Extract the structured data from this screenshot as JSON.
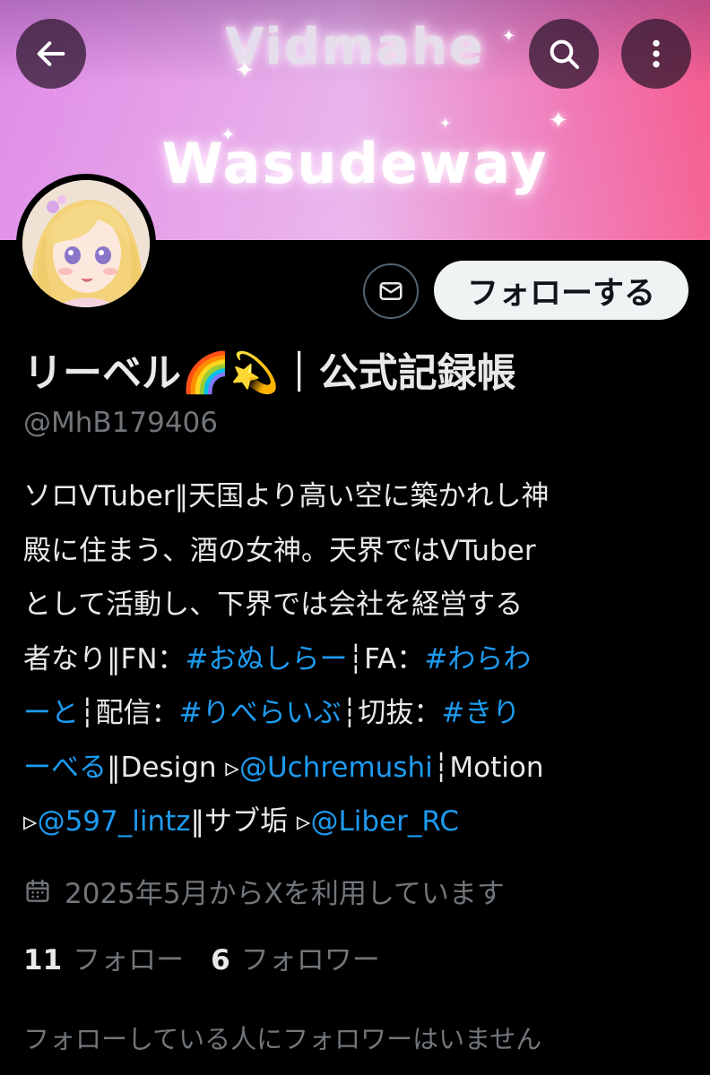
{
  "banner": {
    "line1": "Vidmahe",
    "line2": "Wasudeway"
  },
  "header": {
    "back_icon": "arrow-left-icon",
    "search_icon": "search-icon",
    "more_icon": "more-vertical-icon"
  },
  "profile": {
    "display_name": "リーベル🌈💫｜公式記録帳",
    "handle": "@MhB179406",
    "follow_label": "フォローする",
    "message_icon": "mail-icon"
  },
  "bio": {
    "l1": "ソロVTuber‖天国より高い空に築かれし神",
    "l2": "殿に住まう、酒の女神。天界ではVTuber",
    "l3": "として活動し、下界では会社を経営する",
    "l4_a": "者なり‖FN：",
    "l4_b": "#おぬしらー",
    "l4_c": "┆FA：",
    "l4_d": "#わらわ",
    "l5_a": "ーと",
    "l5_b": "┆配信：",
    "l5_c": "#りべらいぶ",
    "l5_d": "┆切抜：",
    "l5_e": "#きり",
    "l6_a": "ーべる",
    "l6_b": "‖Design ▹",
    "l6_c": "@Uchremushi",
    "l6_d": "┆Motion",
    "l7_a": "▹",
    "l7_b": "@597_lintz",
    "l7_c": "‖サブ垢 ▹",
    "l7_d": "@Liber_RC"
  },
  "joined": {
    "text": "2025年5月からXを利用しています",
    "icon": "calendar-icon"
  },
  "stats": {
    "following_count": "11",
    "following_label": "フォロー",
    "followers_count": "6",
    "followers_label": "フォロワー"
  },
  "mutual_note": "フォローしている人にフォロワーはいません",
  "colors": {
    "background": "#000000",
    "link": "#1d9bf0",
    "secondary_text": "#71767b",
    "primary_text": "#e7e9ea"
  }
}
